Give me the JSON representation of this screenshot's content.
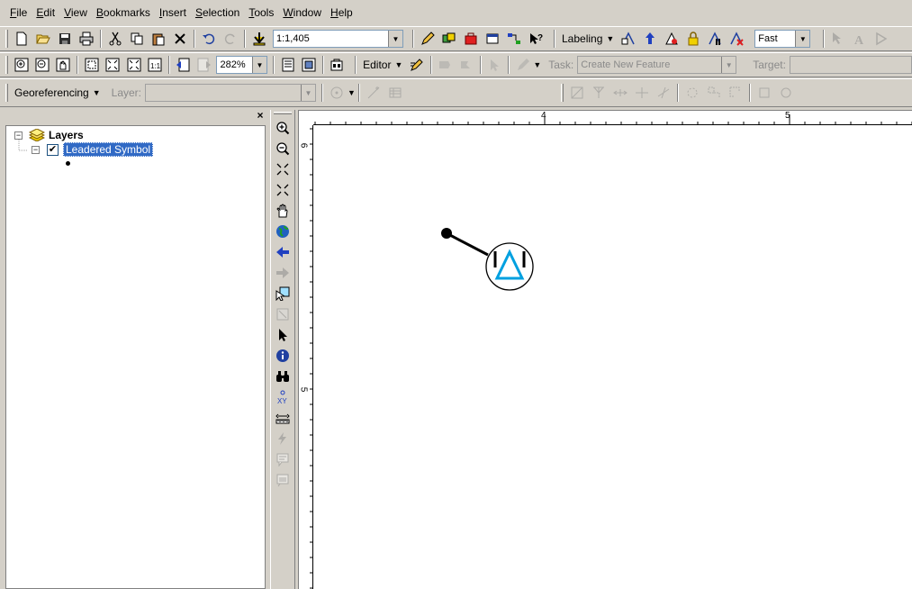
{
  "menu": {
    "items": [
      {
        "key": "F",
        "rest": "ile"
      },
      {
        "key": "E",
        "rest": "dit"
      },
      {
        "key": "V",
        "rest": "iew"
      },
      {
        "key": "B",
        "rest": "ookmarks"
      },
      {
        "key": "I",
        "rest": "nsert"
      },
      {
        "key": "S",
        "rest": "election"
      },
      {
        "key": "T",
        "rest": "ools"
      },
      {
        "key": "W",
        "rest": "indow"
      },
      {
        "key": "H",
        "rest": "elp"
      }
    ]
  },
  "standard_toolbar": {
    "scale_value": "1:1,405"
  },
  "labeling_toolbar": {
    "label": "Labeling",
    "quality_value": "Fast"
  },
  "layout_toolbar": {
    "zoom_value": "282%"
  },
  "editor_toolbar": {
    "editor_label": "Editor",
    "task_label": "Task:",
    "task_value": "Create New Feature",
    "target_label": "Target:",
    "target_value": ""
  },
  "georef_toolbar": {
    "label": "Georeferencing",
    "layer_label": "Layer:",
    "layer_value": ""
  },
  "toc": {
    "root_label": "Layers",
    "layer_label": "Leadered Symbol",
    "layer_checked": true
  },
  "ruler": {
    "top_labels": [
      "4",
      "5"
    ],
    "left_labels": [
      "6",
      "5"
    ]
  },
  "colors": {
    "selection": "#316ac5",
    "symbol_triangle": "#00a0e0"
  }
}
